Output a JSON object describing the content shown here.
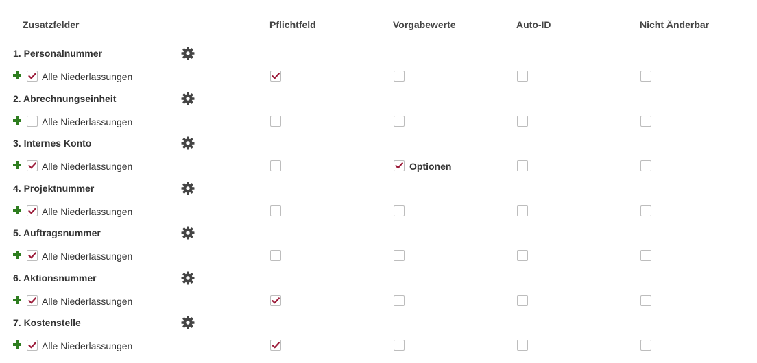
{
  "colors": {
    "check": "#9c1c3a",
    "plus": "#2e7d1f",
    "gear": "#444444"
  },
  "headers": {
    "zusatzfelder": "Zusatzfelder",
    "pflichtfeld": "Pflichtfeld",
    "vorgabewerte": "Vorgabewerte",
    "auto_id": "Auto-ID",
    "nicht_aenderbar": "Nicht Änderbar"
  },
  "rows": [
    {
      "title": "1. Personalnummer",
      "scope_label": "Alle Niederlassungen",
      "scope_checked": true,
      "pflichtfeld": true,
      "vorgabewerte": false,
      "auto_id": false,
      "nicht_aenderbar": false
    },
    {
      "title": "2. Abrechnungseinheit",
      "scope_label": "Alle Niederlassungen",
      "scope_checked": false,
      "pflichtfeld": false,
      "vorgabewerte": false,
      "auto_id": false,
      "nicht_aenderbar": false
    },
    {
      "title": "3. Internes Konto",
      "scope_label": "Alle Niederlassungen",
      "scope_checked": true,
      "pflichtfeld": false,
      "vorgabewerte": true,
      "vorgabewerte_label": "Optionen",
      "auto_id": false,
      "nicht_aenderbar": false
    },
    {
      "title": "4. Projektnummer",
      "scope_label": "Alle Niederlassungen",
      "scope_checked": true,
      "pflichtfeld": false,
      "vorgabewerte": false,
      "auto_id": false,
      "nicht_aenderbar": false
    },
    {
      "title": "5. Auftragsnummer",
      "scope_label": "Alle Niederlassungen",
      "scope_checked": true,
      "pflichtfeld": false,
      "vorgabewerte": false,
      "auto_id": false,
      "nicht_aenderbar": false
    },
    {
      "title": "6. Aktionsnummer",
      "scope_label": "Alle Niederlassungen",
      "scope_checked": true,
      "pflichtfeld": true,
      "vorgabewerte": false,
      "auto_id": false,
      "nicht_aenderbar": false
    },
    {
      "title": "7. Kostenstelle",
      "scope_label": "Alle Niederlassungen",
      "scope_checked": true,
      "pflichtfeld": true,
      "vorgabewerte": false,
      "auto_id": false,
      "nicht_aenderbar": false
    }
  ]
}
